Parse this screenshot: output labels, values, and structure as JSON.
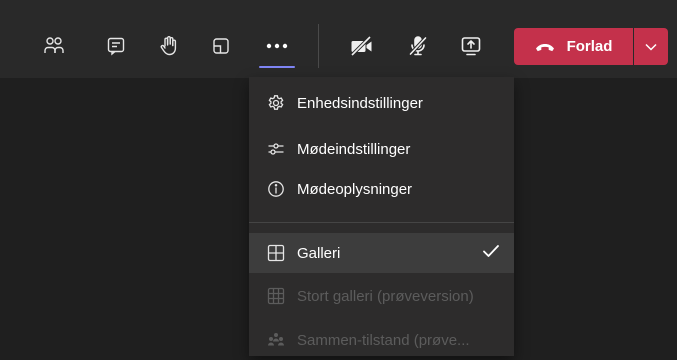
{
  "toolbar": {
    "icons": {
      "participants": "people-icon",
      "chat": "chat-icon",
      "raise_hand": "raise-hand-icon",
      "rooms": "breakout-rooms-icon",
      "more": "more-actions-icon",
      "camera": "camera-off-icon",
      "mic": "mic-off-icon",
      "share": "share-screen-icon"
    },
    "leave_label": "Forlad",
    "leave_color": "#c4314b",
    "accent_color": "#7f85f5"
  },
  "menu": {
    "items": [
      {
        "label": "Enhedsindstillinger",
        "icon": "gear-icon",
        "disabled": false,
        "selected": false
      },
      {
        "label": "Mødeindstillinger",
        "icon": "sliders-icon",
        "disabled": false,
        "selected": false
      },
      {
        "label": "Mødeoplysninger",
        "icon": "info-icon",
        "disabled": false,
        "selected": false
      },
      {
        "label": "Galleri",
        "icon": "gallery-grid-icon",
        "disabled": false,
        "selected": true
      },
      {
        "label": "Stort galleri (prøveversion)",
        "icon": "large-gallery-icon",
        "disabled": true,
        "selected": false
      },
      {
        "label": "Sammen-tilstand (prøve...",
        "icon": "together-mode-icon",
        "disabled": true,
        "selected": false
      }
    ]
  }
}
